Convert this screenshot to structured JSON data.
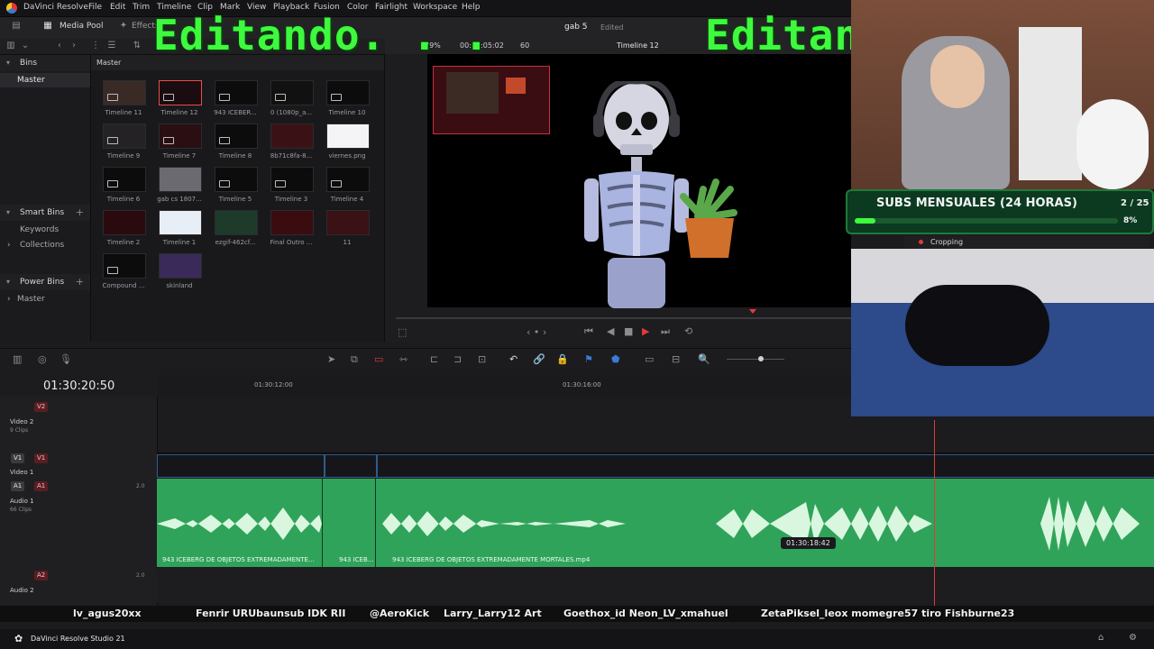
{
  "menubar": {
    "app": "DaVinci Resolve",
    "items": [
      "File",
      "Edit",
      "Trim",
      "Timeline",
      "Clip",
      "Mark",
      "View",
      "Playback",
      "Fusion",
      "Color",
      "Fairlight",
      "Workspace",
      "Help"
    ]
  },
  "toolbar": {
    "media_pool": "Media Pool",
    "effects": "Effects"
  },
  "overlay": {
    "left": "Editando. . .",
    "right": "Editan"
  },
  "viewer": {
    "zoom": "39%",
    "timecode": "00:42:05:02",
    "fps": "60",
    "project": "gab 5",
    "status": "Edited",
    "timeline": "Timeline 12"
  },
  "bins": {
    "title": "Bins",
    "master": "Master",
    "smart_bins": "Smart Bins",
    "keywords": "Keywords",
    "collections": "Collections",
    "power_bins": "Power Bins",
    "power_master": "Master"
  },
  "mediapool": {
    "header": "Master",
    "clips": [
      "Timeline 11",
      "Timeline 12",
      "943 ICEBER...",
      "0 (1080p_a...",
      "Timeline 10",
      "Timeline 9",
      "Timeline 7",
      "Timeline 8",
      "8b71c8fa-8...",
      "viernes.png",
      "Timeline 6",
      "gab cs 1807...",
      "Timeline 5",
      "Timeline 3",
      "Timeline 4",
      "Timeline 2",
      "Timeline 1",
      "ezgif-462cf...",
      "Final Outro ...",
      "11",
      "Compound ...",
      "skinland"
    ]
  },
  "timeline": {
    "timecode": "01:30:20:50",
    "ruler": [
      "01:30:12:00",
      "01:30:16:00"
    ],
    "tracks": {
      "v2": {
        "badge": "V2",
        "name": "Video 2",
        "sub": "9 Clips"
      },
      "v1": {
        "badge_a": "V1",
        "badge_b": "V1",
        "name": "Video 1"
      },
      "a1": {
        "badge_a": "A1",
        "badge_b": "A1",
        "name": "Audio 1",
        "sub": "66 Clips",
        "level": "2.0"
      },
      "a2": {
        "badge": "A2",
        "name": "Audio 2",
        "level": "2.0"
      }
    },
    "audio_clips": [
      "943 ICEBERG DE OBJETOS EXTREMADAMENTE...",
      "943 ICEB...",
      "943 ICEBERG DE OBJETOS EXTREMADAMENTE MORTALES.mp4"
    ],
    "hover_tc": "01:30:18:42"
  },
  "stream": {
    "subs": "SUBS MENSUALES (24 HORAS)",
    "count": "2 / 25",
    "pct": "8%",
    "progress": 0.08,
    "cropping": "Cropping"
  },
  "chat": {
    "names": [
      "lv_agus20xx",
      "Fenrir URUbaunsub IDK RII",
      "@AeroKick",
      "Larry_Larry12 Art",
      "Goethox_id Neon_LV_xmahuel",
      "ZetaPiksel_leox momegre57 tiro Fishburne23"
    ]
  },
  "taskbar": {
    "label": "DaVinci Resolve Studio 21"
  },
  "colors": {
    "accent_green": "#3ef93e",
    "audio_green": "#2fa35a",
    "playhead": "#e23a3a"
  }
}
